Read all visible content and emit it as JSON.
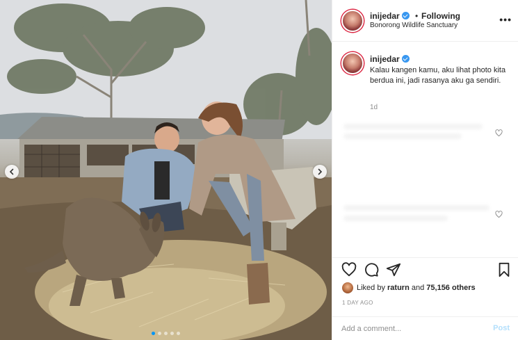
{
  "post": {
    "username": "inijedar",
    "verified": true,
    "follow_status": "Following",
    "separator": "•",
    "location": "Bonorong Wildlife Sanctuary",
    "more_label": "•••",
    "caption": "Kalau kangen kamu, aku lihat photo kita berdua ini, jadi rasanya aku ga sendiri.",
    "caption_age": "1d",
    "likes_text_prefix": "Liked by ",
    "likes_user": "raturn",
    "likes_middle": " and ",
    "likes_count": "75,156 others",
    "time_ago": "1 DAY AGO",
    "comment_placeholder": "Add a comment...",
    "post_label": "Post"
  },
  "icons": {
    "prev": "chevron-left-icon",
    "next": "chevron-right-icon",
    "like": "heart-icon",
    "comment": "comment-icon",
    "share": "share-icon",
    "save": "bookmark-icon",
    "options": "more-icon"
  },
  "carousel": {
    "slide_count": 5,
    "active_slide": 1
  },
  "colors": {
    "accent": "#0095f6",
    "verified": "#3897f0",
    "text": "#262626",
    "muted": "#8e8e8e",
    "post_disabled": "#b2dffc"
  }
}
